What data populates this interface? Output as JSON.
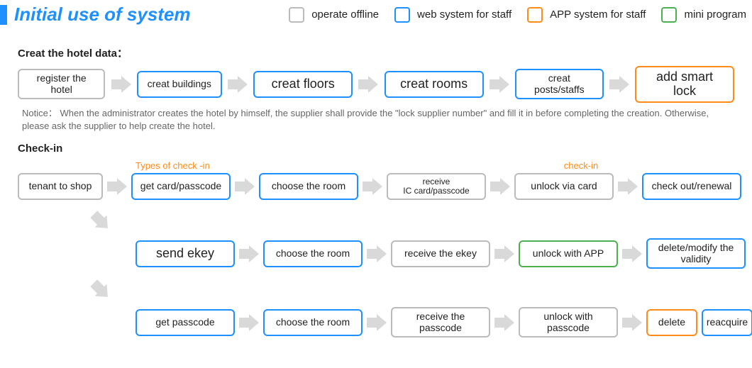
{
  "header": {
    "title": "Initial use of system",
    "legend": {
      "offline": "operate offline",
      "web": "web system for staff",
      "app": "APP system for staff",
      "mini": "mini program"
    }
  },
  "hotel": {
    "title": "Creat the hotel data：",
    "steps": {
      "register": "register the hotel",
      "buildings": "creat buildings",
      "floors": "creat floors",
      "rooms": "creat rooms",
      "posts": "creat posts/staffs",
      "smartlock": "add smart lock"
    },
    "notice": "Notice： When the administrator creates the hotel by himself, the supplier shall provide the \"lock supplier number\" and fill it in before completing the creation. Otherwise, please ask the supplier to help create the hotel."
  },
  "checkin": {
    "title": "Check-in",
    "annot_types": "Types of check -in",
    "annot_checkin": "check-in",
    "tenant": "tenant to shop",
    "row1": {
      "a": "get card/passcode",
      "b": "choose the room",
      "c": "receive\nIC card/passcode",
      "d": "unlock via card",
      "e": "check out/renewal"
    },
    "row2": {
      "a": "send ekey",
      "b": "choose the room",
      "c": "receive the ekey",
      "d": "unlock with APP",
      "e": "delete/modify the validity"
    },
    "row3": {
      "a": "get passcode",
      "b": "choose the room",
      "c": "receive the passcode",
      "d": "unlock with passcode",
      "e1": "delete",
      "e2": "reacquire"
    }
  }
}
